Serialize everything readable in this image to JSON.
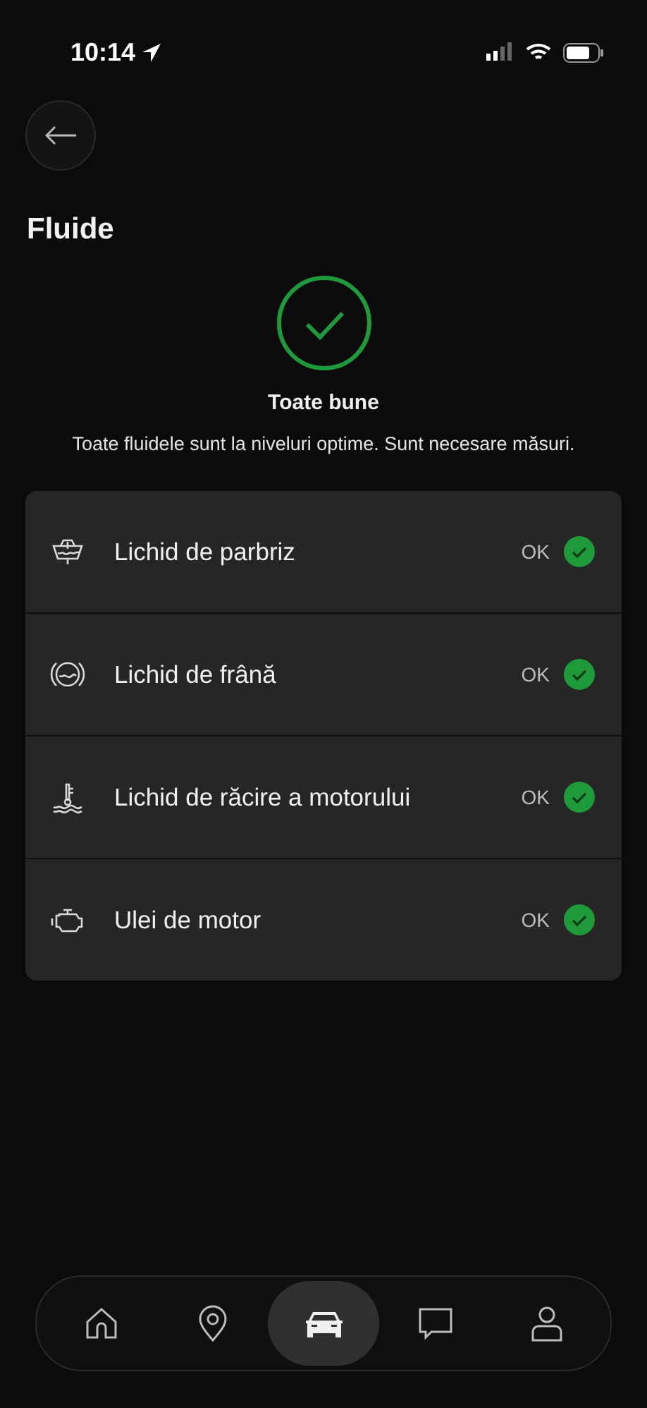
{
  "status_bar": {
    "time": "10:14"
  },
  "header": {
    "title": "Fluide"
  },
  "summary": {
    "ok": true,
    "title": "Toate bune",
    "message": "Toate fluidele sunt la niveluri optime. Sunt necesare măsuri."
  },
  "fluids": [
    {
      "kind": "washer",
      "name": "Lichid de parbriz",
      "status": "OK",
      "ok": true
    },
    {
      "kind": "brake",
      "name": "Lichid de frână",
      "status": "OK",
      "ok": true
    },
    {
      "kind": "coolant",
      "name": "Lichid de răcire a motorului",
      "status": "OK",
      "ok": true
    },
    {
      "kind": "oil",
      "name": "Ulei de motor",
      "status": "OK",
      "ok": true
    }
  ],
  "nav": [
    {
      "kind": "home",
      "selected": false
    },
    {
      "kind": "location",
      "selected": false
    },
    {
      "kind": "car",
      "selected": true
    },
    {
      "kind": "chat",
      "selected": false
    },
    {
      "kind": "profile",
      "selected": false
    }
  ]
}
